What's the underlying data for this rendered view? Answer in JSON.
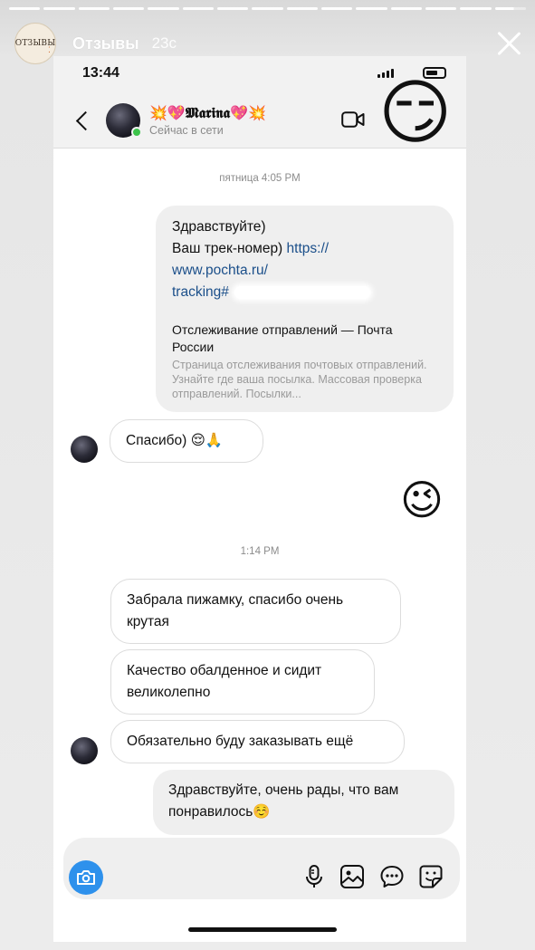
{
  "story": {
    "account_name": "Отзывы",
    "avatar_text": "ОТЗЫВЫ",
    "time_ago": "23с"
  },
  "status_bar": {
    "clock": "13:44"
  },
  "chat": {
    "contact_name": "💥💖𝕸𝖆𝖗𝖎𝖓𝖆💖💥",
    "contact_status": "Сейчас в сети",
    "separator_1": "пятница 4:05 PM",
    "separator_2": "1:14 PM",
    "messages": [
      {
        "line1": "Здравствуйте)",
        "line2_text": "Ваш трек-номер) ",
        "link_a": "https://",
        "link_b": "www.pochta.ru/",
        "link_c": "tracking#",
        "preview_title": "Отслеживание отправлений — Почта России",
        "preview_desc": "Страница отслеживания почтовых отправлений. Узнайте где ваша посылка. Массовая проверка отправлений. Посылки..."
      },
      {
        "text": "Спасибо) 😌🙏"
      },
      {
        "emoji": "😉"
      },
      {
        "text": "Забрала пижамку, спасибо очень крутая"
      },
      {
        "text": "Качество обалденное и сидит великолепно"
      },
      {
        "text": "Обязательно буду заказывать ещё"
      },
      {
        "text": "Здравствуйте, очень рады, что вам понравилось☺️"
      }
    ]
  },
  "sticker_emoji": "😏",
  "colors": {
    "accent": "#2e91ec",
    "online": "#3cc34a",
    "link": "#1b4f8a"
  },
  "icons": [
    "camera-icon",
    "microphone-icon",
    "image-icon",
    "chat-bubble-icon",
    "sticker-icon",
    "video-call-icon",
    "back-chevron-icon",
    "close-icon"
  ]
}
